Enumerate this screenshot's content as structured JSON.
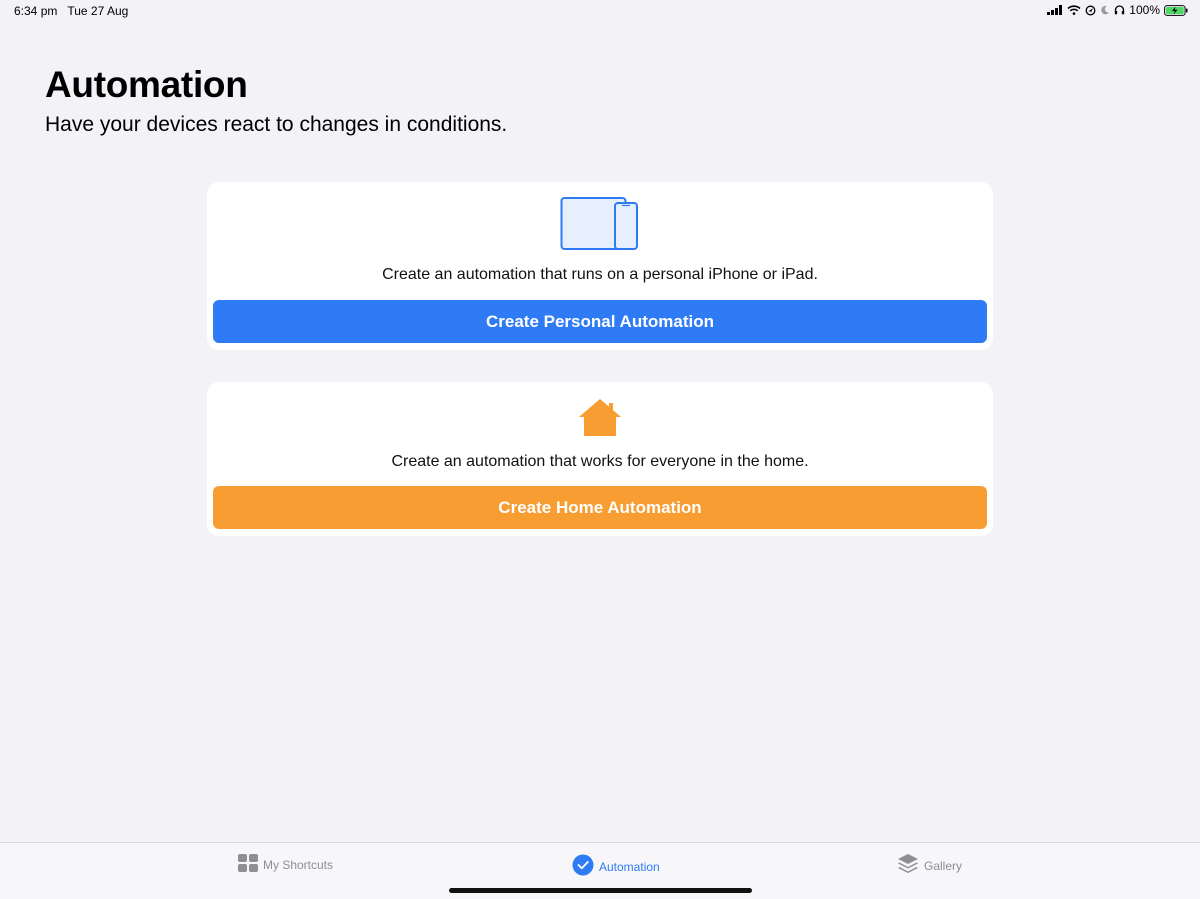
{
  "status_bar": {
    "time": "6:34 pm",
    "date": "Tue 27 Aug",
    "battery": "100%",
    "icons": [
      "signal-icon",
      "wifi-icon",
      "location-icon",
      "moon-icon",
      "headphones-icon",
      "battery-charging-icon"
    ]
  },
  "header": {
    "title": "Automation",
    "subtitle": "Have your devices react to changes in conditions."
  },
  "personal_card": {
    "icon": "devices-icon",
    "description": "Create an automation that runs on a personal iPhone or iPad.",
    "button_label": "Create Personal Automation"
  },
  "home_card": {
    "icon": "home-icon",
    "description": "Create an automation that works for everyone in the home.",
    "button_label": "Create Home Automation"
  },
  "tab_bar": {
    "tabs": [
      {
        "label": "My Shortcuts",
        "icon": "grid-icon",
        "selected": false
      },
      {
        "label": "Automation",
        "icon": "automation-check-icon",
        "selected": true
      },
      {
        "label": "Gallery",
        "icon": "layers-icon",
        "selected": false
      }
    ]
  },
  "colors": {
    "background": "#f2f2f7",
    "accent_blue": "#2f7bf5",
    "accent_orange": "#f79d31",
    "tab_inactive": "#8e8e93"
  }
}
